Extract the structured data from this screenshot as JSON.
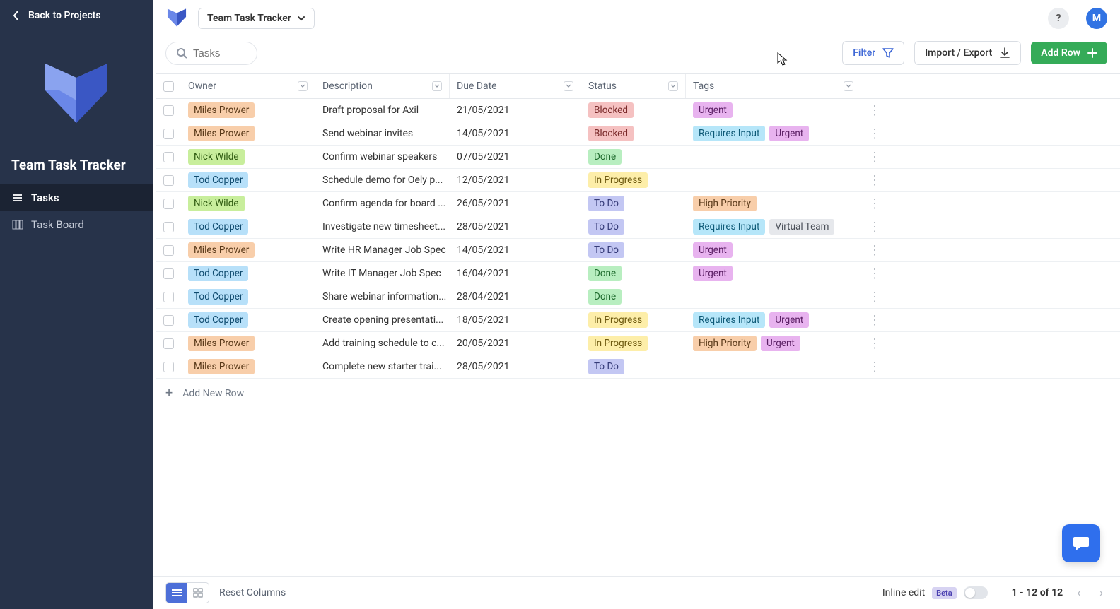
{
  "sidebar": {
    "back_label": "Back to Projects",
    "title": "Team Task Tracker",
    "nav": [
      {
        "label": "Tasks",
        "active": true,
        "icon": "list-icon"
      },
      {
        "label": "Task Board",
        "active": false,
        "icon": "board-icon"
      }
    ]
  },
  "header": {
    "project_name": "Team Task Tracker",
    "avatar_initial": "M"
  },
  "toolbar": {
    "search_placeholder": "Tasks",
    "filter_label": "Filter",
    "import_export_label": "Import / Export",
    "add_row_label": "Add Row"
  },
  "columns": [
    "Owner",
    "Description",
    "Due Date",
    "Status",
    "Tags"
  ],
  "owner_styles": {
    "Miles Prower": "owner-miles",
    "Nick Wilde": "owner-nick",
    "Tod Copper": "owner-tod"
  },
  "status_styles": {
    "Blocked": "status-blocked",
    "Done": "status-done",
    "In Progress": "status-inprogress",
    "To Do": "status-todo"
  },
  "tag_styles": {
    "Urgent": "tag-urgent",
    "Requires Input": "tag-requires",
    "High Priority": "tag-highpriority",
    "Virtual Team": "tag-virtual"
  },
  "rows": [
    {
      "owner": "Miles Prower",
      "description": "Draft proposal for Axil",
      "due": "21/05/2021",
      "status": "Blocked",
      "tags": [
        "Urgent"
      ]
    },
    {
      "owner": "Miles Prower",
      "description": "Send webinar invites",
      "due": "14/05/2021",
      "status": "Blocked",
      "tags": [
        "Requires Input",
        "Urgent"
      ]
    },
    {
      "owner": "Nick Wilde",
      "description": "Confirm webinar speakers",
      "due": "07/05/2021",
      "status": "Done",
      "tags": []
    },
    {
      "owner": "Tod Copper",
      "description": "Schedule demo for Oely p...",
      "due": "12/05/2021",
      "status": "In Progress",
      "tags": []
    },
    {
      "owner": "Nick Wilde",
      "description": "Confirm agenda for board ...",
      "due": "26/05/2021",
      "status": "To Do",
      "tags": [
        "High Priority"
      ]
    },
    {
      "owner": "Tod Copper",
      "description": "Investigate new timesheet...",
      "due": "28/05/2021",
      "status": "To Do",
      "tags": [
        "Requires Input",
        "Virtual Team"
      ]
    },
    {
      "owner": "Miles Prower",
      "description": "Write HR Manager Job Spec",
      "due": "14/05/2021",
      "status": "To Do",
      "tags": [
        "Urgent"
      ]
    },
    {
      "owner": "Tod Copper",
      "description": "Write IT Manager Job Spec",
      "due": "16/04/2021",
      "status": "Done",
      "tags": [
        "Urgent"
      ]
    },
    {
      "owner": "Tod Copper",
      "description": "Share webinar information...",
      "due": "28/04/2021",
      "status": "Done",
      "tags": []
    },
    {
      "owner": "Tod Copper",
      "description": "Create opening presentati...",
      "due": "18/05/2021",
      "status": "In Progress",
      "tags": [
        "Requires Input",
        "Urgent"
      ]
    },
    {
      "owner": "Miles Prower",
      "description": "Add training schedule to c...",
      "due": "20/05/2021",
      "status": "In Progress",
      "tags": [
        "High Priority",
        "Urgent"
      ]
    },
    {
      "owner": "Miles Prower",
      "description": "Complete new starter trai...",
      "due": "28/05/2021",
      "status": "To Do",
      "tags": []
    }
  ],
  "add_new_row_label": "Add New Row",
  "footer": {
    "reset_columns_label": "Reset Columns",
    "inline_edit_label": "Inline edit",
    "beta_label": "Beta",
    "page_info": "1 - 12 of 12"
  }
}
